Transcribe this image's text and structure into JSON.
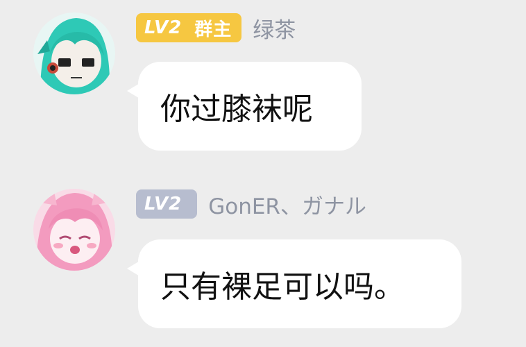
{
  "messages": [
    {
      "avatar": "anime-avatar-green-hair",
      "level": "LV2",
      "role": "群主",
      "badge_color": "#f6c741",
      "nickname": "绿茶",
      "text": "你过膝袜呢"
    },
    {
      "avatar": "anime-avatar-pink-hair",
      "level": "LV2",
      "role": "",
      "badge_color": "#b7bdcf",
      "nickname": "GonER、ガナル",
      "text": "只有裸足可以吗。"
    }
  ]
}
